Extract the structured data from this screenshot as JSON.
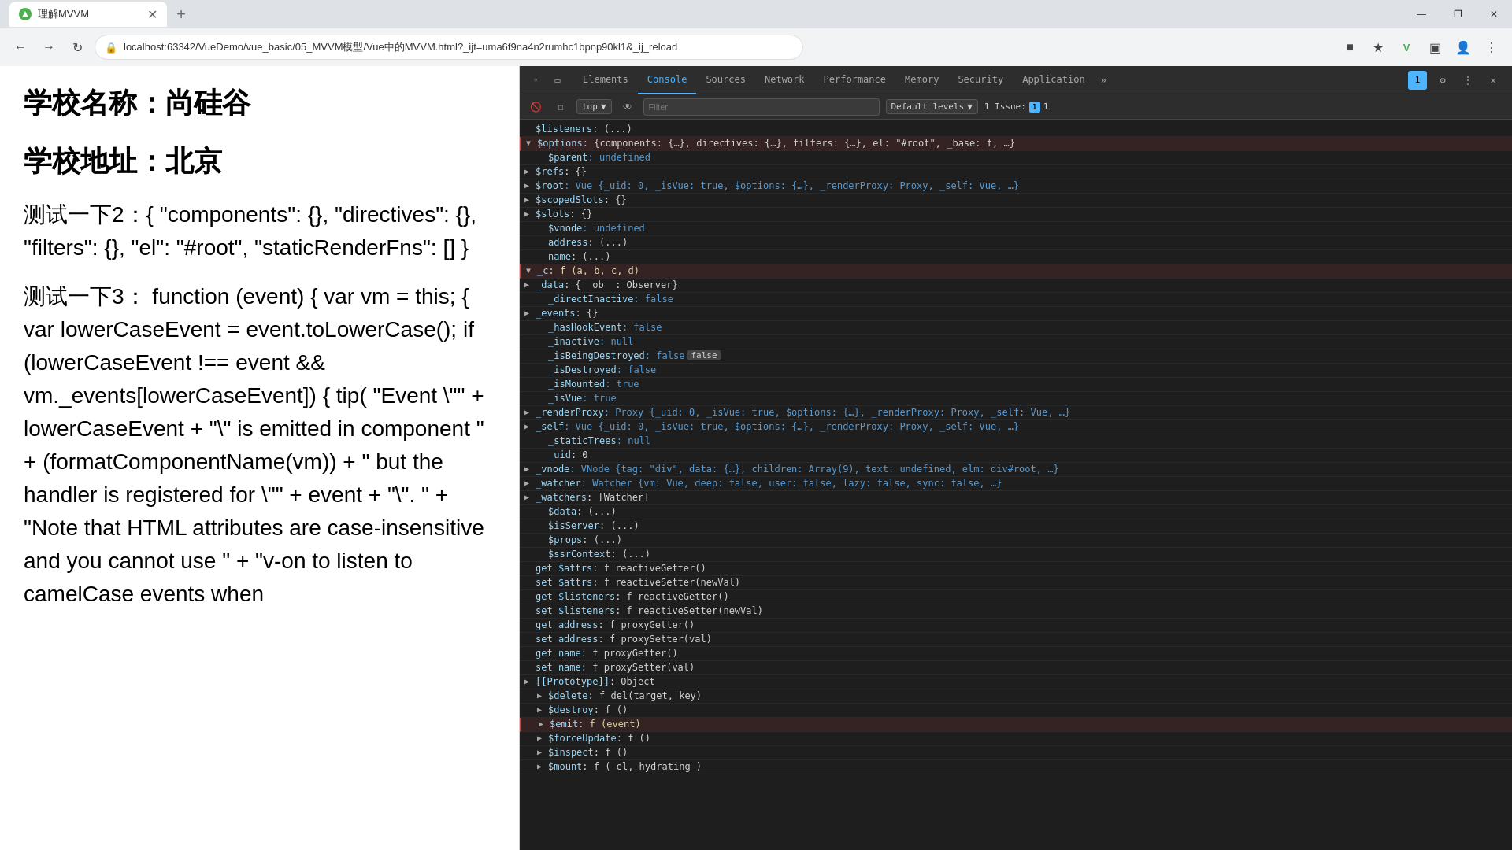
{
  "browser": {
    "tab_title": "理解MVVM",
    "address": "localhost:63342/VueDemo/vue_basic/05_MVVM模型/Vue中的MVVM.html?_ijt=uma6f9na4n2rumhc1bpnp90kl1&_ij_reload",
    "new_tab_btn": "+",
    "win_minimize": "—",
    "win_maximize": "❐",
    "win_close": "✕"
  },
  "devtools": {
    "tabs": [
      "Elements",
      "Console",
      "Sources",
      "Network",
      "Performance",
      "Memory",
      "Security",
      "Application"
    ],
    "active_tab": "Console",
    "more_label": "»",
    "context": "top",
    "filter_placeholder": "Filter",
    "levels": "Default levels",
    "issue_label": "1 Issue:",
    "issue_count": "1"
  },
  "page": {
    "school_name_label": "学校名称：",
    "school_name_value": "尚硅谷",
    "school_addr_label": "学校地址：",
    "school_addr_value": "北京",
    "test2_label": "测试一下2：",
    "test2_value": "{ \"components\": {}, \"directives\": {}, \"filters\": {}, \"el\": \"#root\", \"staticRenderFns\": [] }",
    "test3_label": "测试一下3：",
    "test3_value": "function (event) { var vm = this; { var lowerCaseEvent = event.toLowerCase(); if (lowerCaseEvent !== event && vm._events[lowerCaseEvent]) { tip( \"Event \\\"\" + lowerCaseEvent + \"\\\" is emitted in component \" + (formatComponentName(vm)) + \" but the handler is registered for \\\"\" + event + \"\\\". \" + \"Note that HTML attributes are case-insensitive and you cannot use \" + \"v-on to listen to camelCase events when"
  },
  "console": {
    "lines": [
      {
        "indent": 0,
        "expandable": false,
        "content": "$listeners: (...)"
      },
      {
        "indent": 0,
        "expandable": true,
        "expanded": true,
        "content": "$options: {components: {…}, directives: {…}, filters: {…}, el: \"#root\", _base: f, …}",
        "highlighted": true
      },
      {
        "indent": 1,
        "expandable": false,
        "content": "$parent: undefined"
      },
      {
        "indent": 0,
        "expandable": true,
        "content": "$refs: {}"
      },
      {
        "indent": 0,
        "expandable": true,
        "content": "$root: Vue {_uid: 0, _isVue: true, $options: {…}, _renderProxy: Proxy, _self: Vue, …}"
      },
      {
        "indent": 0,
        "expandable": true,
        "content": "$scopedSlots: {}"
      },
      {
        "indent": 0,
        "expandable": true,
        "content": "$slots: {}"
      },
      {
        "indent": 1,
        "expandable": false,
        "content": "$vnode: undefined"
      },
      {
        "indent": 1,
        "expandable": false,
        "content": "address: (...)"
      },
      {
        "indent": 1,
        "expandable": false,
        "content": "name: (...)"
      },
      {
        "indent": 0,
        "expandable": true,
        "expanded": true,
        "content": "_c: f (a, b, c, d)",
        "highlighted": true
      },
      {
        "indent": 0,
        "expandable": true,
        "content": "_data: {__ob__: Observer}"
      },
      {
        "indent": 1,
        "expandable": false,
        "content": "_directInactive: false"
      },
      {
        "indent": 0,
        "expandable": true,
        "content": "_events: {}"
      },
      {
        "indent": 1,
        "expandable": false,
        "content": "_hasHookEvent: false"
      },
      {
        "indent": 1,
        "expandable": false,
        "content": "_inactive: null"
      },
      {
        "indent": 1,
        "expandable": false,
        "content": "_isBeingDestroyed: false",
        "tooltip": "false"
      },
      {
        "indent": 1,
        "expandable": false,
        "content": "_isDestroyed: false"
      },
      {
        "indent": 1,
        "expandable": false,
        "content": "_isMounted: true"
      },
      {
        "indent": 1,
        "expandable": false,
        "content": "_isVue: true"
      },
      {
        "indent": 0,
        "expandable": true,
        "content": "_renderProxy: Proxy {_uid: 0, _isVue: true, $options: {…}, _renderProxy: Proxy, _self: Vue, …}"
      },
      {
        "indent": 0,
        "expandable": true,
        "content": "_self: Vue {_uid: 0, _isVue: true, $options: {…}, _renderProxy: Proxy, _self: Vue, …}"
      },
      {
        "indent": 1,
        "expandable": false,
        "content": "_staticTrees: null"
      },
      {
        "indent": 1,
        "expandable": false,
        "content": "_uid: 0"
      },
      {
        "indent": 0,
        "expandable": true,
        "content": "_vnode: VNode {tag: \"div\", data: {…}, children: Array(9), text: undefined, elm: div#root, …}"
      },
      {
        "indent": 0,
        "expandable": true,
        "content": "_watcher: Watcher {vm: Vue, deep: false, user: false, lazy: false, sync: false, …}"
      },
      {
        "indent": 0,
        "expandable": true,
        "content": "_watchers: [Watcher]"
      },
      {
        "indent": 1,
        "expandable": false,
        "content": "$data: (...)"
      },
      {
        "indent": 1,
        "expandable": false,
        "content": "$isServer: (...)"
      },
      {
        "indent": 1,
        "expandable": false,
        "content": "$props: (...)"
      },
      {
        "indent": 1,
        "expandable": false,
        "content": "$ssrContext: (...)"
      },
      {
        "indent": 0,
        "expandable": false,
        "content": "get $attrs: f reactiveGetter()"
      },
      {
        "indent": 0,
        "expandable": false,
        "content": "set $attrs: f reactiveSetter(newVal)"
      },
      {
        "indent": 0,
        "expandable": false,
        "content": "get $listeners: f reactiveGetter()"
      },
      {
        "indent": 0,
        "expandable": false,
        "content": "set $listeners: f reactiveSetter(newVal)"
      },
      {
        "indent": 0,
        "expandable": false,
        "content": "get address: f proxyGetter()"
      },
      {
        "indent": 0,
        "expandable": false,
        "content": "set address: f proxySetter(val)"
      },
      {
        "indent": 0,
        "expandable": false,
        "content": "get name: f proxyGetter()"
      },
      {
        "indent": 0,
        "expandable": false,
        "content": "set name: f proxySetter(val)"
      },
      {
        "indent": 0,
        "expandable": true,
        "content": "[[Prototype]]: Object"
      },
      {
        "indent": 1,
        "expandable": true,
        "content": "$delete: f del(target, key)"
      },
      {
        "indent": 1,
        "expandable": true,
        "content": "$destroy: f ()"
      },
      {
        "indent": 1,
        "expandable": true,
        "content": "$emit: f (event)",
        "highlighted": true
      },
      {
        "indent": 1,
        "expandable": true,
        "content": "$forceUpdate: f ()"
      },
      {
        "indent": 1,
        "expandable": true,
        "content": "$inspect: f ()"
      },
      {
        "indent": 1,
        "expandable": true,
        "content": "$mount: f ( el, hydrating )"
      }
    ]
  }
}
